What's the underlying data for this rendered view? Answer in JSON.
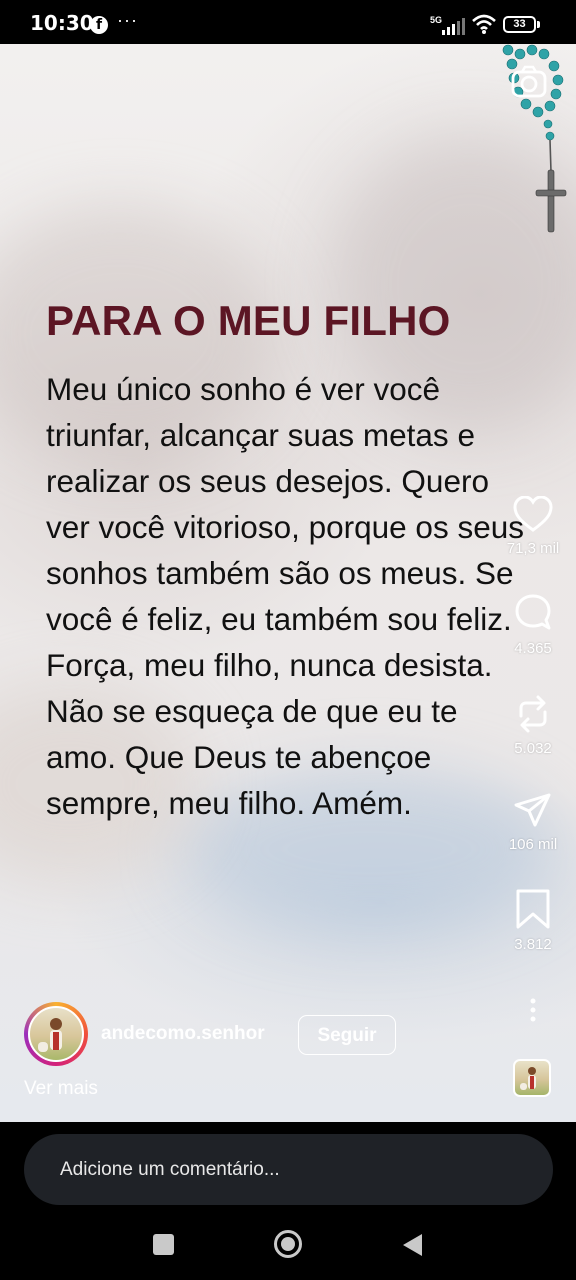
{
  "status_bar": {
    "time": "10:30",
    "app_icon": "facebook-icon",
    "dots": "···",
    "network": "5G",
    "battery": "33"
  },
  "post": {
    "title": "PARA O MEU FILHO",
    "body": "Meu único sonho é ver você triunfar, alcançar suas metas e realizar os seus desejos. Quero ver você vitorioso, porque os seus sonhos também são os meus. Se você é feliz, eu também sou feliz. Força, meu filho, nunca desista. Não se esqueça de que eu te amo. Que Deus te abençoe sempre, meu filho. Amém."
  },
  "actions": {
    "likes": "71,3 mil",
    "comments": "4.365",
    "reposts": "5.032",
    "shares": "106 mil",
    "saves": "3.812"
  },
  "author": {
    "username": "andecomo.senhor",
    "follow_label": "Seguir",
    "see_more": "Ver mais"
  },
  "comment": {
    "placeholder": "Adicione um comentário..."
  },
  "colors": {
    "title": "#5c1624",
    "body_text": "#111111",
    "comment_box": "#1f2227"
  }
}
